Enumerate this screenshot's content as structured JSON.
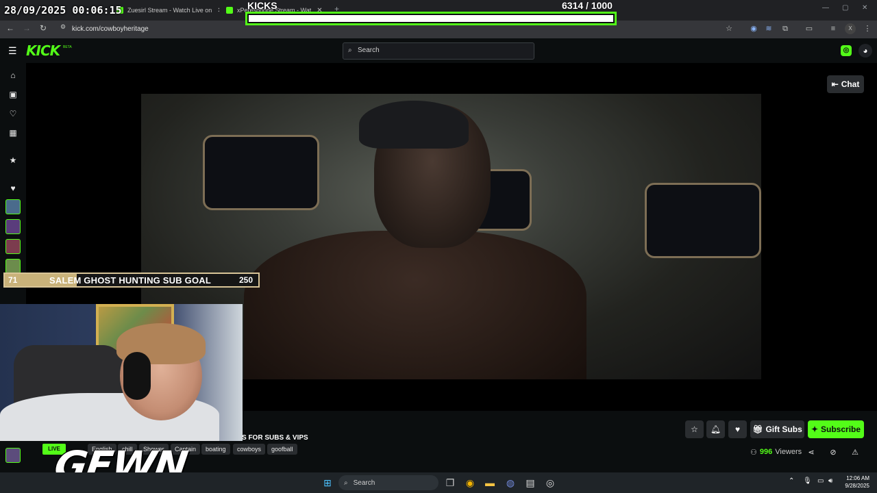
{
  "overlay": {
    "datetime": "28/09/2025 00:06:15",
    "kicks_label": "KICKS",
    "kicks_count": "6314  / 1000",
    "kicks_progress": 1.0
  },
  "browser": {
    "tabs": [
      {
        "label": "Zuesirl Stream - Watch Live on",
        "close": "✕"
      },
      {
        "label": "xPeresphone Stream - Wat",
        "close": "✕"
      }
    ],
    "new_tab": "+",
    "url": "kick.com/cowboyheritage",
    "icons": [
      "back-icon",
      "forward-icon",
      "reload-icon",
      "site-info-icon",
      "star-icon",
      "extension-icon",
      "profile-icon",
      "menu-icon"
    ]
  },
  "header": {
    "logo": "KICK",
    "logo_badge": "BETA",
    "search_placeholder": "Search"
  },
  "player": {
    "chat_label": "Chat"
  },
  "sub_goal": {
    "start": "71",
    "title": "SALEM GHOST HUNTING SUB GOAL",
    "end": "250",
    "progress": 0.284
  },
  "stream": {
    "title": "S FOR SUBS & VIPS",
    "live_label": "LIVE",
    "tags": [
      "English",
      "chill",
      "Shower",
      "Captain",
      "boating",
      "cowboys",
      "goofball"
    ],
    "viewers_count": "996",
    "viewers_label": "Viewers"
  },
  "actions": {
    "gift_subs_label": "Gift Subs",
    "subscribe_label": "Subscribe"
  },
  "watermark": "GEWN",
  "taskbar": {
    "search_label": "Search",
    "time": "12:06 AM",
    "date": "9/28/2025"
  },
  "colors": {
    "accent": "#53fc18",
    "background": "#0b0e0f",
    "subgoal_fill": "#c9b27a"
  }
}
